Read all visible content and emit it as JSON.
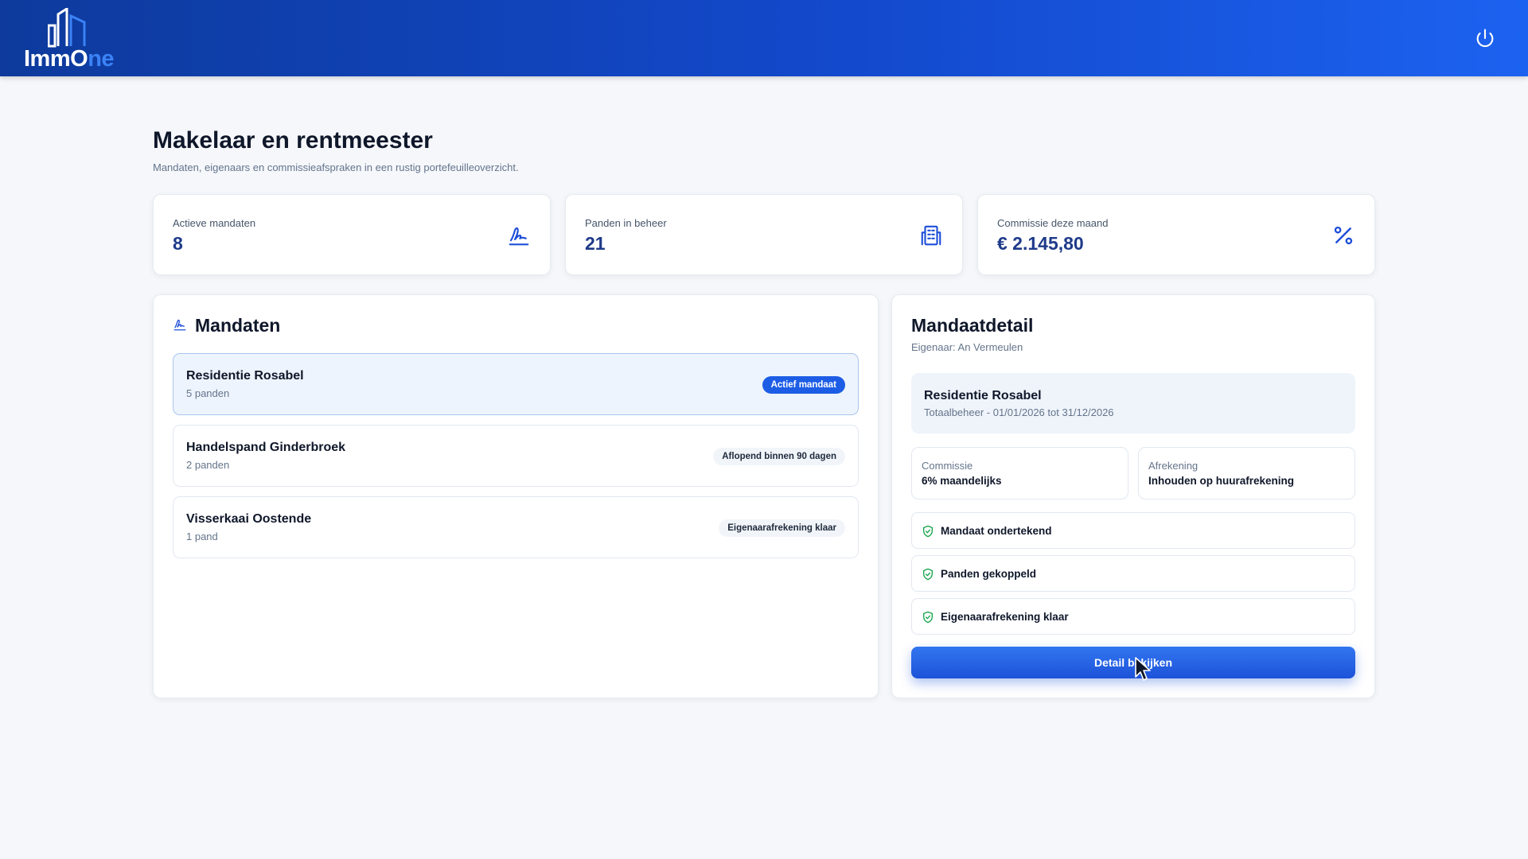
{
  "app": {
    "logo_main": "ImmO",
    "logo_accent": "ne",
    "power_icon": "power-icon"
  },
  "colors": {
    "header_start": "#0d3a9c",
    "header_end": "#1c62f0",
    "accent": "#1d5de6",
    "value_text": "#1e3a8a",
    "check_green": "#16a34a"
  },
  "page": {
    "title": "Makelaar en rentmeester",
    "subtitle": "Mandaten, eigenaars en commissieafspraken in een rustig portefeuilleoverzicht."
  },
  "stats": [
    {
      "label": "Actieve mandaten",
      "value": "8",
      "icon": "signature-icon"
    },
    {
      "label": "Panden in beheer",
      "value": "21",
      "icon": "building-icon"
    },
    {
      "label": "Commissie deze maand",
      "value": "€ 2.145,80",
      "icon": "percent-icon"
    }
  ],
  "mandates": {
    "title": "Mandaten",
    "icon": "signature-icon",
    "items": [
      {
        "name": "Residentie Rosabel",
        "count": "5 panden",
        "badge": "Actief mandaat",
        "active": true
      },
      {
        "name": "Handelspand Ginderbroek",
        "count": "2 panden",
        "badge": "Aflopend binnen 90 dagen",
        "active": false
      },
      {
        "name": "Visserkaai Oostende",
        "count": "1 pand",
        "badge": "Eigenaarafrekening klaar",
        "active": false
      }
    ]
  },
  "detail": {
    "title": "Mandaatdetail",
    "owner": "Eigenaar: An Vermeulen",
    "property": "Residentie Rosabel",
    "range": "Totaalbeheer - 01/01/2026 tot 31/12/2026",
    "commission_label": "Commissie",
    "commission_value": "6% maandelijks",
    "settlement_label": "Afrekening",
    "settlement_value": "Inhouden op huurafrekening",
    "checks": [
      {
        "label": "Mandaat ondertekend",
        "icon": "shield-check-icon"
      },
      {
        "label": "Panden gekoppeld",
        "icon": "shield-check-icon"
      },
      {
        "label": "Eigenaarafrekening klaar",
        "icon": "shield-check-icon"
      }
    ],
    "button": "Detail bekijken"
  }
}
